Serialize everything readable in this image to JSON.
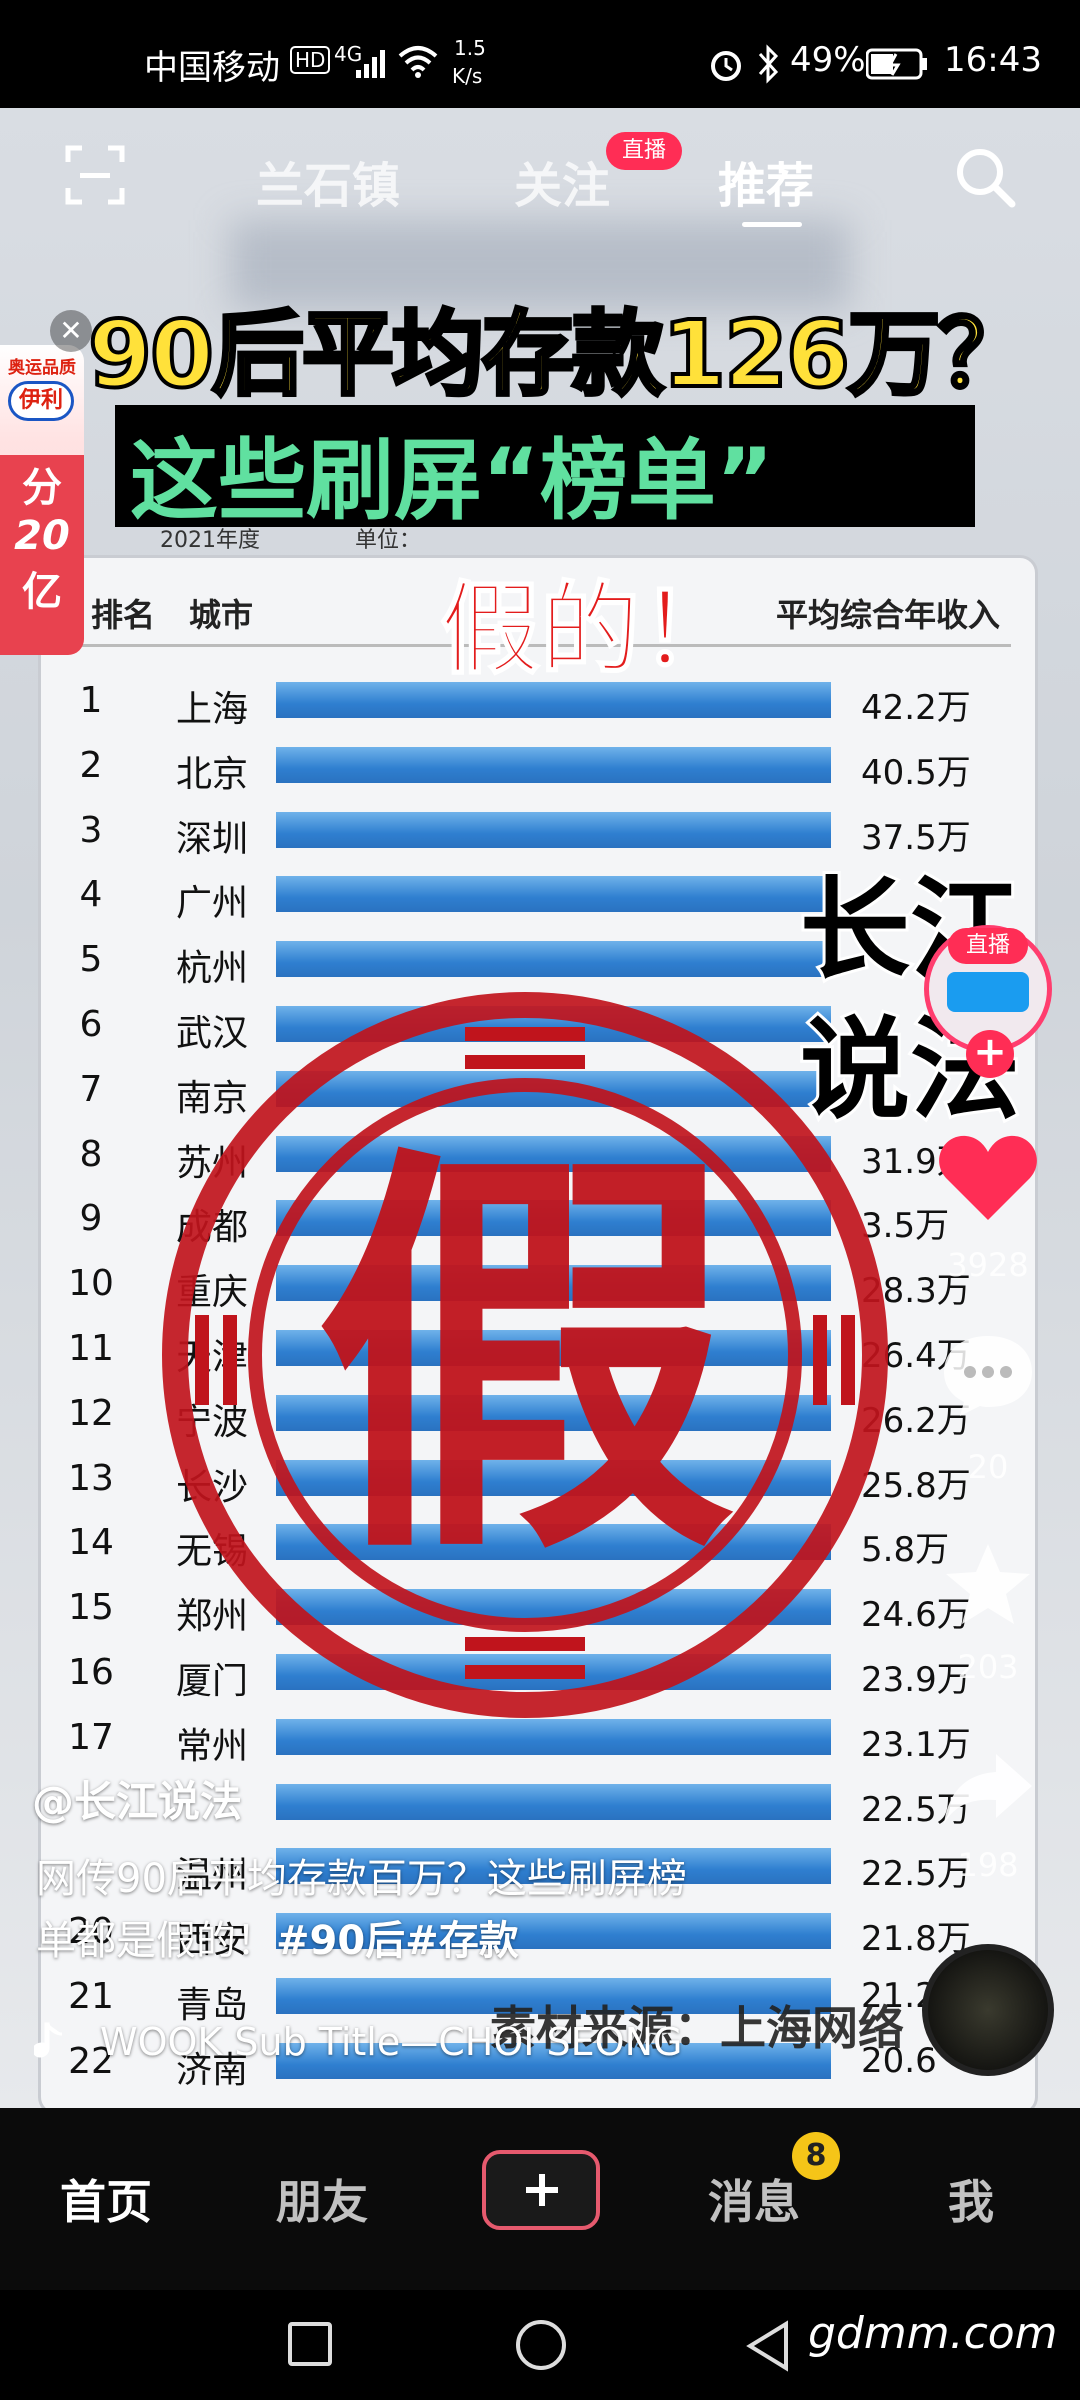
{
  "status_bar": {
    "carrier": "中国移动",
    "hd": "HD",
    "network": "4G",
    "speed_value": "1.5",
    "speed_unit": "K/s",
    "battery": "49%",
    "time": "16:43"
  },
  "top_nav": {
    "tabs": [
      {
        "label": "兰石镇"
      },
      {
        "label": "关注"
      },
      {
        "label": "推荐"
      }
    ],
    "live_badge": "直播"
  },
  "video": {
    "headline_1": "90后平均存款126万？",
    "headline_2": "这些刷屏“榜单”",
    "headline_3": "假的！",
    "stamp_char": "假",
    "brand_line_1": "长江",
    "brand_line_2": "说法",
    "table": {
      "header_rank": "排名",
      "header_city": "城市",
      "header_value": "平均综合年收入",
      "behind_year": "2021年度",
      "behind_unit": "单位：",
      "rows": [
        {
          "rank": "1",
          "city": "上海",
          "value": "42.2万"
        },
        {
          "rank": "2",
          "city": "北京",
          "value": "40.5万"
        },
        {
          "rank": "3",
          "city": "深圳",
          "value": "37.5万"
        },
        {
          "rank": "4",
          "city": "广州",
          "value": ""
        },
        {
          "rank": "5",
          "city": "杭州",
          "value": ""
        },
        {
          "rank": "6",
          "city": "武汉",
          "value": ""
        },
        {
          "rank": "7",
          "city": "南京",
          "value": ""
        },
        {
          "rank": "8",
          "city": "苏州",
          "value": "31.9万"
        },
        {
          "rank": "9",
          "city": "成都",
          "value": "3.5万"
        },
        {
          "rank": "10",
          "city": "重庆",
          "value": "28.3万"
        },
        {
          "rank": "11",
          "city": "天津",
          "value": "26.4万"
        },
        {
          "rank": "12",
          "city": "宁波",
          "value": "26.2万"
        },
        {
          "rank": "13",
          "city": "长沙",
          "value": "25.8万"
        },
        {
          "rank": "14",
          "city": "无锡",
          "value": "5.8万"
        },
        {
          "rank": "15",
          "city": "郑州",
          "value": "24.6万"
        },
        {
          "rank": "16",
          "city": "厦门",
          "value": "23.9万"
        },
        {
          "rank": "17",
          "city": "常州",
          "value": "23.1万"
        },
        {
          "rank": "",
          "city": "",
          "value": "22.5万"
        },
        {
          "rank": "",
          "city": "温州",
          "value": "22.5万"
        },
        {
          "rank": "20",
          "city": "西安",
          "value": "21.8万"
        },
        {
          "rank": "21",
          "city": "青岛",
          "value": "21.2"
        },
        {
          "rank": "22",
          "city": "济南",
          "value": "20.6"
        }
      ]
    },
    "source_text": "素材来源：上海网络"
  },
  "ad": {
    "brand": "伊利",
    "top_text": "奥运品质",
    "line_1": "分",
    "line_2": "20",
    "line_3": "亿"
  },
  "right_rail": {
    "avatar_live": "直播",
    "likes": "3928",
    "comments": "20",
    "favorites": "203",
    "shares": "198"
  },
  "caption": {
    "author": "@长江说法",
    "line_1": "网传90后平均存款百万？这些刷屏榜",
    "line_2_text": "单都是假的！",
    "hashtags": "#90后#存款",
    "music": "WOOK  Sub Title—CHOI SEONG"
  },
  "bottom_nav": {
    "home": "首页",
    "friends": "朋友",
    "messages": "消息",
    "messages_badge": "8",
    "me": "我"
  },
  "watermark": "gdmm.com",
  "colors": {
    "accent_red": "#ff2d55",
    "headline_yellow": "#ffe13a",
    "headline_green": "#60e0a0",
    "stamp_red": "#c0141c",
    "bar_blue": "#2f7fd0"
  }
}
